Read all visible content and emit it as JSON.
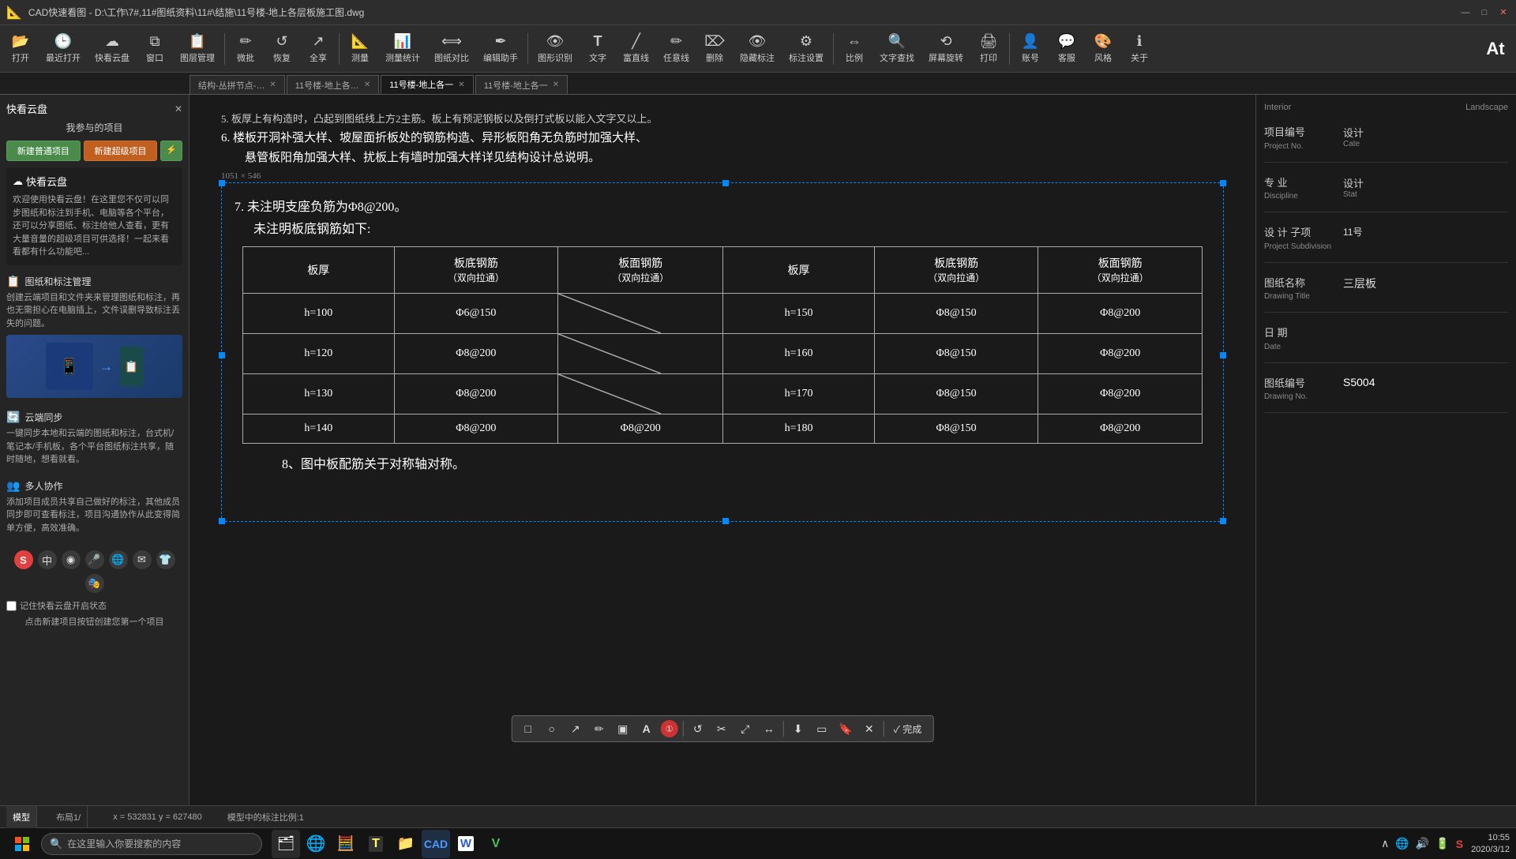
{
  "titlebar": {
    "title": "CAD快速看图 - D:\\工作\\7#,11#图纸资料\\11#\\结施\\11号楼-地上各层板施工图.dwg",
    "minimize": "—",
    "maximize": "□",
    "close": "✕"
  },
  "toolbar": {
    "buttons": [
      {
        "id": "open",
        "icon": "📂",
        "label": "打开"
      },
      {
        "id": "recent",
        "icon": "🕒",
        "label": "最近打开"
      },
      {
        "id": "cloud",
        "icon": "☁",
        "label": "快看云盘"
      },
      {
        "id": "window",
        "icon": "⧉",
        "label": "窗口"
      },
      {
        "id": "layers",
        "icon": "📋",
        "label": "图层管理"
      },
      {
        "id": "markup",
        "icon": "✏",
        "label": "微批"
      },
      {
        "id": "restore",
        "icon": "↺",
        "label": "恢复"
      },
      {
        "id": "share",
        "icon": "↗",
        "label": "全享"
      },
      {
        "id": "measure",
        "icon": "📐",
        "label": "测量"
      },
      {
        "id": "stats",
        "icon": "📊",
        "label": "测量统计"
      },
      {
        "id": "compare",
        "icon": "⟺",
        "label": "图纸对比"
      },
      {
        "id": "editor",
        "icon": "✒",
        "label": "编辑助手"
      },
      {
        "id": "recognize",
        "icon": "👁",
        "label": "图形识别"
      },
      {
        "id": "text",
        "icon": "T",
        "label": "文字"
      },
      {
        "id": "straight",
        "icon": "╱",
        "label": "富直线"
      },
      {
        "id": "casual",
        "icon": "✏",
        "label": "任意线"
      },
      {
        "id": "delete",
        "icon": "⌦",
        "label": "删除"
      },
      {
        "id": "hide",
        "icon": "👁",
        "label": "隐藏标注"
      },
      {
        "id": "label_settings",
        "icon": "⚙",
        "label": "标注设置"
      },
      {
        "id": "scale",
        "icon": "⇔",
        "label": "比例"
      },
      {
        "id": "text_find",
        "icon": "🔍",
        "label": "文字查找"
      },
      {
        "id": "rotate_screen",
        "icon": "⟲",
        "label": "屏幕旋转"
      },
      {
        "id": "print",
        "icon": "🖨",
        "label": "打印"
      },
      {
        "id": "account",
        "icon": "👤",
        "label": "账号"
      },
      {
        "id": "service",
        "icon": "💬",
        "label": "客服"
      },
      {
        "id": "style",
        "icon": "🎨",
        "label": "风格"
      },
      {
        "id": "about",
        "icon": "ℹ",
        "label": "关于"
      }
    ]
  },
  "tabs": [
    {
      "id": "tab1",
      "label": "结构-丛拼节点-…",
      "active": false,
      "closeable": true
    },
    {
      "id": "tab2",
      "label": "11号楼-地上各…",
      "active": false,
      "closeable": true
    },
    {
      "id": "tab3",
      "label": "11号楼-地上各一",
      "active": true,
      "closeable": true
    },
    {
      "id": "tab4",
      "label": "11号楼-地上各一",
      "active": false,
      "closeable": true
    }
  ],
  "sidebar": {
    "title": "快看云盘",
    "my_projects_label": "我参与的项目",
    "new_normal_btn": "新建普通项目",
    "new_super_btn": "新建超级项目",
    "lightning_btn": "⚡",
    "cloud_section": {
      "title": "快看云盘",
      "content": "欢迎使用快看云盘！在这里您不仅可以同步图纸和标注到手机、电脑等各个平台，还可以分享图纸、标注给他人查看，更有大量音量的超级项目可供选择！一起来看看都有什么功能吧..."
    },
    "sections": [
      {
        "id": "doc-management",
        "icon": "📋",
        "title": "图纸和标注管理",
        "content": "创建云端项目和文件夹来管理图纸和标注，再也无需担心在电脑插上，文件误删导致标注丢失的问题。"
      },
      {
        "id": "cloud-sync",
        "icon": "🔄",
        "title": "云端同步",
        "content": "一键同步本地和云端的图纸和标注，台式机/笔记本/手机板，各个平台图纸标注共享，随时随地，想看就看。"
      },
      {
        "id": "collaboration",
        "icon": "👥",
        "title": "多人协作",
        "content": "添加项目成员共享自己做好的标注，其他成员同步即可查看标注，项目沟通协作从此变得简单方便，高效准确。"
      }
    ],
    "bottom_icons": [
      "S",
      "中",
      "◉",
      "🎤",
      "🌐",
      "✉",
      "👕",
      "🎭"
    ],
    "remember_state": "记住快看云盘开启状态",
    "new_project_hint": "点击新建项目按钮创建您第一个项目"
  },
  "cad_drawing": {
    "notes": [
      "5. 板厚上有构造时，凸起到图纸线上方2主筋。板上有预泥钢板以及倒打式板以能入文字又以上。",
      "6. 楼板开洞补强大样、坡屋面折板处的钢筋构造、异形板阳角无负筋时加强大样、悬管板阳角加强大样、扰板上有墙时加强大样详见结构设计总说明。",
      "7. 未注明支座负筋为Φ8@200。",
      "   未注明板底钢筋如下:"
    ],
    "dimension_label": "1051 × 546",
    "note8": "8、图中板配筋关于对称轴对称。",
    "table": {
      "headers_left": [
        "板厚",
        "板底钢筋\n（双向拉通）",
        "板面钢筋\n（双向拉通）"
      ],
      "headers_right": [
        "板厚",
        "板底钢筋\n（双向拉通）",
        "板面钢筋\n（双向拉通）"
      ],
      "rows": [
        {
          "left_thickness": "h=100",
          "left_bottom": "Φ6@150",
          "left_top": "",
          "right_thickness": "h=150",
          "right_bottom": "Φ8@150",
          "right_top": "Φ8@200"
        },
        {
          "left_thickness": "h=120",
          "left_bottom": "Φ8@200",
          "left_top": "",
          "right_thickness": "h=160",
          "right_bottom": "Φ8@150",
          "right_top": "Φ8@200"
        },
        {
          "left_thickness": "h=130",
          "left_bottom": "Φ8@200",
          "left_top": "",
          "right_thickness": "h=170",
          "right_bottom": "Φ8@150",
          "right_top": "Φ8@200"
        },
        {
          "left_thickness": "h=140",
          "left_bottom": "Φ8@200",
          "left_top": "Φ8@200",
          "right_thickness": "h=180",
          "right_bottom": "Φ8@150",
          "right_top": "Φ8@200"
        }
      ]
    }
  },
  "float_toolbar": {
    "tools": [
      {
        "id": "rect",
        "icon": "□",
        "label": "rectangle"
      },
      {
        "id": "circle",
        "icon": "○",
        "label": "circle"
      },
      {
        "id": "arrow",
        "icon": "↗",
        "label": "arrow"
      },
      {
        "id": "pen",
        "icon": "✏",
        "label": "pen"
      },
      {
        "id": "rectfill",
        "icon": "▣",
        "label": "fill-rect"
      },
      {
        "id": "text",
        "icon": "A",
        "label": "text"
      },
      {
        "id": "info",
        "icon": "①",
        "label": "info"
      },
      {
        "id": "undo",
        "icon": "↺",
        "label": "undo"
      },
      {
        "id": "scissors",
        "icon": "✂",
        "label": "cut"
      },
      {
        "id": "resize",
        "icon": "⤢",
        "label": "resize"
      },
      {
        "id": "arrows",
        "icon": "↔",
        "label": "arrows"
      },
      {
        "id": "download",
        "icon": "⬇",
        "label": "download"
      },
      {
        "id": "screen",
        "icon": "▭",
        "label": "screen"
      },
      {
        "id": "bookmark",
        "icon": "🔖",
        "label": "bookmark"
      },
      {
        "id": "close",
        "icon": "✕",
        "label": "close"
      }
    ],
    "done_label": "✓ 完成"
  },
  "right_panel": {
    "top_labels": [
      "Interior",
      "Land"
    ],
    "fields": [
      {
        "id": "project-no",
        "label_cn": "项目编号",
        "label_en": "Project No.",
        "value_label_cn": "设计",
        "value_label_en": "Cate"
      },
      {
        "id": "discipline",
        "label_cn": "专    业",
        "label_en": "Discipline",
        "value_label_cn": "设计",
        "value_label_en": "Stat"
      },
      {
        "id": "design-sub",
        "label_cn": "设 计 子项",
        "label_en": "Project Subdivision",
        "value": "11号"
      },
      {
        "id": "drawing-title",
        "label_cn": "图纸名称",
        "label_en": "Drawing Title",
        "value": "三层板"
      },
      {
        "id": "date",
        "label_cn": "日    期",
        "label_en": "Date",
        "value": ""
      },
      {
        "id": "drawing-no",
        "label_cn": "图纸编号",
        "label_en": "Drawing No.",
        "value": "S5004"
      }
    ]
  },
  "statusbar": {
    "model_tab": "模型",
    "layout_tab": "布局1/",
    "scale_text": "模型中的标注比例:1",
    "coords": "x = 532831  y = 627480"
  },
  "taskbar": {
    "search_placeholder": "在这里输入你要搜索的内容",
    "apps": [
      {
        "id": "explorer",
        "icon": "🗂",
        "label": "File Explorer"
      },
      {
        "id": "edge",
        "icon": "🌐",
        "label": "Edge"
      },
      {
        "id": "calculator",
        "icon": "🧮",
        "label": "Calculator"
      },
      {
        "id": "sticky",
        "icon": "T",
        "label": "Sticky Notes"
      },
      {
        "id": "files",
        "icon": "📁",
        "label": "Files"
      },
      {
        "id": "cad-icon",
        "icon": "⬛",
        "label": "CAD"
      },
      {
        "id": "word",
        "icon": "W",
        "label": "Word"
      },
      {
        "id": "vgreen",
        "icon": "V",
        "label": "App"
      }
    ],
    "tray_icons": [
      "∧",
      "🌐",
      "🔊",
      "🔋"
    ],
    "time": "10:55",
    "date": "2020/3/12",
    "at_label": "At"
  }
}
